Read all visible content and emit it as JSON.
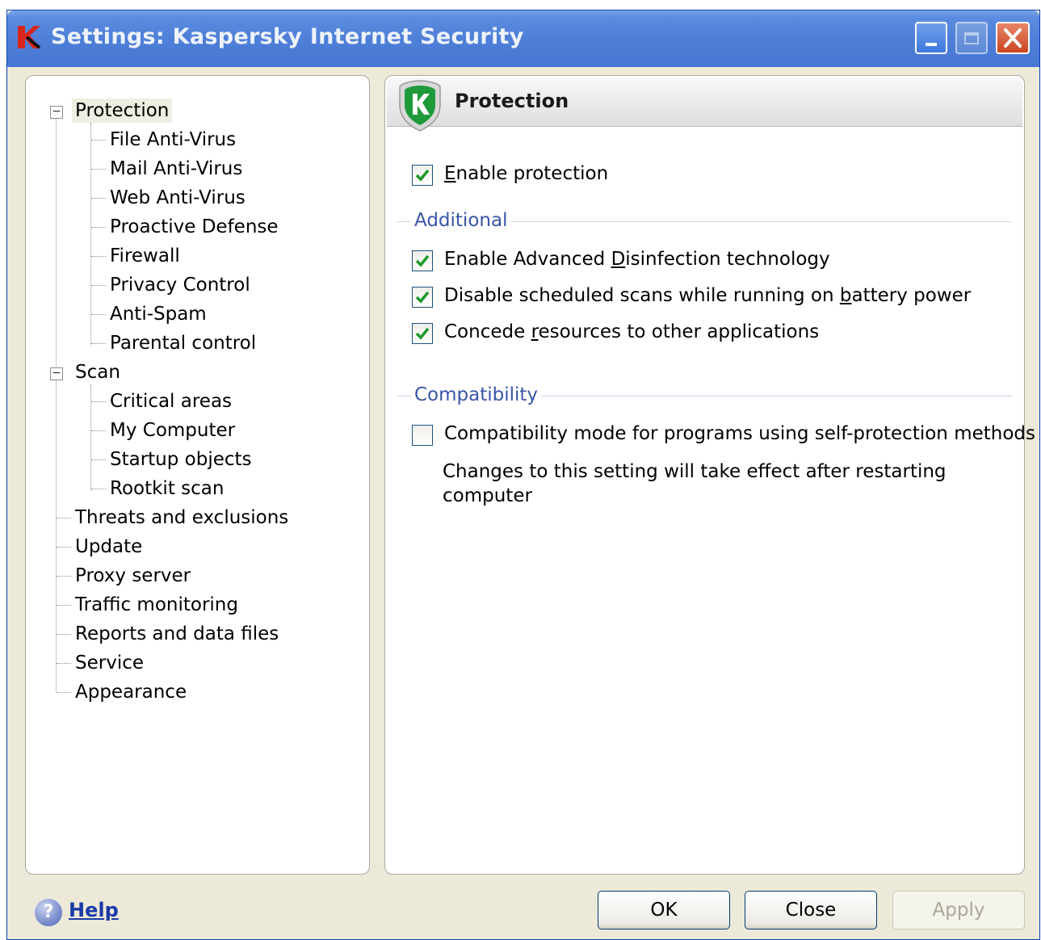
{
  "window": {
    "title": "Settings: Kaspersky Internet Security",
    "controls": [
      "minimize",
      "maximize",
      "close"
    ]
  },
  "nav": {
    "items": [
      {
        "label": "Protection",
        "selected": true,
        "expanded": true
      },
      {
        "label": "File Anti-Virus"
      },
      {
        "label": "Mail Anti-Virus"
      },
      {
        "label": "Web Anti-Virus"
      },
      {
        "label": "Proactive Defense"
      },
      {
        "label": "Firewall"
      },
      {
        "label": "Privacy Control"
      },
      {
        "label": "Anti-Spam"
      },
      {
        "label": "Parental control"
      },
      {
        "label": "Scan",
        "expanded": true
      },
      {
        "label": "Critical areas"
      },
      {
        "label": "My Computer"
      },
      {
        "label": "Startup objects"
      },
      {
        "label": "Rootkit scan"
      },
      {
        "label": "Threats and exclusions"
      },
      {
        "label": "Update"
      },
      {
        "label": "Proxy server"
      },
      {
        "label": "Traffic monitoring"
      },
      {
        "label": "Reports and data files"
      },
      {
        "label": "Service"
      },
      {
        "label": "Appearance"
      }
    ]
  },
  "content": {
    "title": "Protection",
    "enable_protection": {
      "label_pre": "",
      "label_u": "E",
      "label_post": "nable protection",
      "checked": true
    },
    "additional_label": "Additional",
    "advanced_disinfection": {
      "label_pre": "Enable Advanced ",
      "label_u": "D",
      "label_post": "isinfection technology",
      "checked": true
    },
    "disable_scheduled": {
      "label_pre": "Disable scheduled scans while running on ",
      "label_u": "b",
      "label_post": "attery power",
      "checked": true
    },
    "concede_resources": {
      "label_pre": "Concede ",
      "label_u": "r",
      "label_post": "esources to other applications",
      "checked": true
    },
    "compatibility_label": "Compatibility",
    "compatibility_mode": {
      "label": "Compatibility mode for programs using self-protection methods",
      "checked": false
    },
    "restart_note": "Changes to this setting will take effect after restarting computer"
  },
  "footer": {
    "help": "Help",
    "ok": "OK",
    "close": "Close",
    "apply": "Apply",
    "apply_enabled": false
  },
  "colors": {
    "titlebar": "#4f7fd8",
    "group_label": "#3a55a8",
    "check": "#1e9a2a",
    "help_link": "#1a3aa8"
  }
}
